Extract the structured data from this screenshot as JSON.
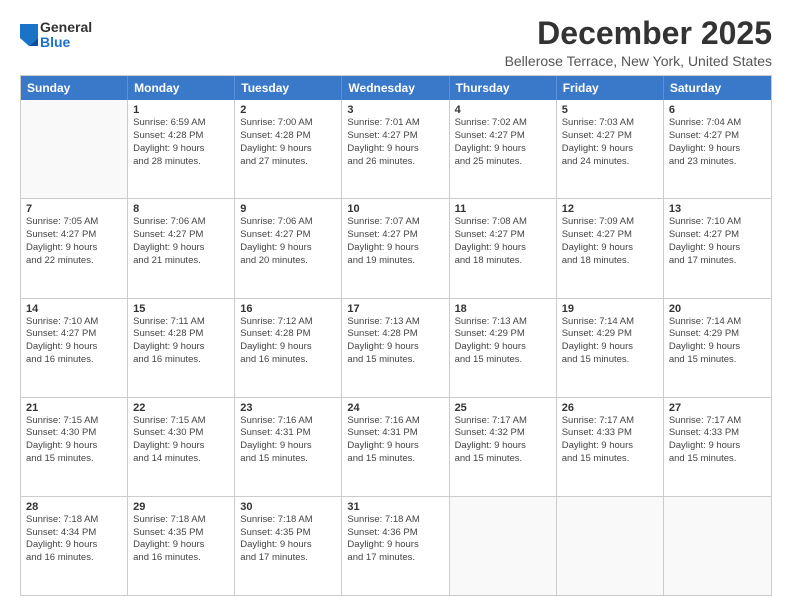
{
  "logo": {
    "general": "General",
    "blue": "Blue"
  },
  "title": "December 2025",
  "subtitle": "Bellerose Terrace, New York, United States",
  "header_days": [
    "Sunday",
    "Monday",
    "Tuesday",
    "Wednesday",
    "Thursday",
    "Friday",
    "Saturday"
  ],
  "weeks": [
    [
      {
        "day": "",
        "info": ""
      },
      {
        "day": "1",
        "info": "Sunrise: 6:59 AM\nSunset: 4:28 PM\nDaylight: 9 hours\nand 28 minutes."
      },
      {
        "day": "2",
        "info": "Sunrise: 7:00 AM\nSunset: 4:28 PM\nDaylight: 9 hours\nand 27 minutes."
      },
      {
        "day": "3",
        "info": "Sunrise: 7:01 AM\nSunset: 4:27 PM\nDaylight: 9 hours\nand 26 minutes."
      },
      {
        "day": "4",
        "info": "Sunrise: 7:02 AM\nSunset: 4:27 PM\nDaylight: 9 hours\nand 25 minutes."
      },
      {
        "day": "5",
        "info": "Sunrise: 7:03 AM\nSunset: 4:27 PM\nDaylight: 9 hours\nand 24 minutes."
      },
      {
        "day": "6",
        "info": "Sunrise: 7:04 AM\nSunset: 4:27 PM\nDaylight: 9 hours\nand 23 minutes."
      }
    ],
    [
      {
        "day": "7",
        "info": "Sunrise: 7:05 AM\nSunset: 4:27 PM\nDaylight: 9 hours\nand 22 minutes."
      },
      {
        "day": "8",
        "info": "Sunrise: 7:06 AM\nSunset: 4:27 PM\nDaylight: 9 hours\nand 21 minutes."
      },
      {
        "day": "9",
        "info": "Sunrise: 7:06 AM\nSunset: 4:27 PM\nDaylight: 9 hours\nand 20 minutes."
      },
      {
        "day": "10",
        "info": "Sunrise: 7:07 AM\nSunset: 4:27 PM\nDaylight: 9 hours\nand 19 minutes."
      },
      {
        "day": "11",
        "info": "Sunrise: 7:08 AM\nSunset: 4:27 PM\nDaylight: 9 hours\nand 18 minutes."
      },
      {
        "day": "12",
        "info": "Sunrise: 7:09 AM\nSunset: 4:27 PM\nDaylight: 9 hours\nand 18 minutes."
      },
      {
        "day": "13",
        "info": "Sunrise: 7:10 AM\nSunset: 4:27 PM\nDaylight: 9 hours\nand 17 minutes."
      }
    ],
    [
      {
        "day": "14",
        "info": "Sunrise: 7:10 AM\nSunset: 4:27 PM\nDaylight: 9 hours\nand 16 minutes."
      },
      {
        "day": "15",
        "info": "Sunrise: 7:11 AM\nSunset: 4:28 PM\nDaylight: 9 hours\nand 16 minutes."
      },
      {
        "day": "16",
        "info": "Sunrise: 7:12 AM\nSunset: 4:28 PM\nDaylight: 9 hours\nand 16 minutes."
      },
      {
        "day": "17",
        "info": "Sunrise: 7:13 AM\nSunset: 4:28 PM\nDaylight: 9 hours\nand 15 minutes."
      },
      {
        "day": "18",
        "info": "Sunrise: 7:13 AM\nSunset: 4:29 PM\nDaylight: 9 hours\nand 15 minutes."
      },
      {
        "day": "19",
        "info": "Sunrise: 7:14 AM\nSunset: 4:29 PM\nDaylight: 9 hours\nand 15 minutes."
      },
      {
        "day": "20",
        "info": "Sunrise: 7:14 AM\nSunset: 4:29 PM\nDaylight: 9 hours\nand 15 minutes."
      }
    ],
    [
      {
        "day": "21",
        "info": "Sunrise: 7:15 AM\nSunset: 4:30 PM\nDaylight: 9 hours\nand 15 minutes."
      },
      {
        "day": "22",
        "info": "Sunrise: 7:15 AM\nSunset: 4:30 PM\nDaylight: 9 hours\nand 14 minutes."
      },
      {
        "day": "23",
        "info": "Sunrise: 7:16 AM\nSunset: 4:31 PM\nDaylight: 9 hours\nand 15 minutes."
      },
      {
        "day": "24",
        "info": "Sunrise: 7:16 AM\nSunset: 4:31 PM\nDaylight: 9 hours\nand 15 minutes."
      },
      {
        "day": "25",
        "info": "Sunrise: 7:17 AM\nSunset: 4:32 PM\nDaylight: 9 hours\nand 15 minutes."
      },
      {
        "day": "26",
        "info": "Sunrise: 7:17 AM\nSunset: 4:33 PM\nDaylight: 9 hours\nand 15 minutes."
      },
      {
        "day": "27",
        "info": "Sunrise: 7:17 AM\nSunset: 4:33 PM\nDaylight: 9 hours\nand 15 minutes."
      }
    ],
    [
      {
        "day": "28",
        "info": "Sunrise: 7:18 AM\nSunset: 4:34 PM\nDaylight: 9 hours\nand 16 minutes."
      },
      {
        "day": "29",
        "info": "Sunrise: 7:18 AM\nSunset: 4:35 PM\nDaylight: 9 hours\nand 16 minutes."
      },
      {
        "day": "30",
        "info": "Sunrise: 7:18 AM\nSunset: 4:35 PM\nDaylight: 9 hours\nand 17 minutes."
      },
      {
        "day": "31",
        "info": "Sunrise: 7:18 AM\nSunset: 4:36 PM\nDaylight: 9 hours\nand 17 minutes."
      },
      {
        "day": "",
        "info": ""
      },
      {
        "day": "",
        "info": ""
      },
      {
        "day": "",
        "info": ""
      }
    ]
  ]
}
